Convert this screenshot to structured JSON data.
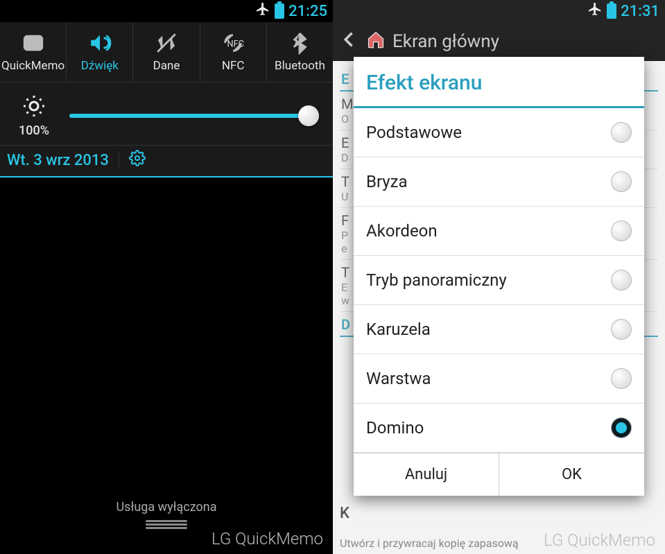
{
  "left": {
    "status": {
      "time": "21:25"
    },
    "toggles": [
      {
        "label": "QuickMemo",
        "active": false
      },
      {
        "label": "Dźwięk",
        "active": true
      },
      {
        "label": "Dane",
        "active": false
      },
      {
        "label": "NFC",
        "active": false
      },
      {
        "label": "Bluetooth",
        "active": false
      }
    ],
    "brightness_pct": "100%",
    "date": "Wt. 3 wrz 2013",
    "service_off": "Usługa wyłączona",
    "brand": "LG QuickMemo"
  },
  "right": {
    "status": {
      "time": "21:31"
    },
    "bg_title": "Ekran główny",
    "dialog": {
      "title": "Efekt ekranu",
      "options": [
        {
          "label": "Podstawowe",
          "selected": false
        },
        {
          "label": "Bryza",
          "selected": false
        },
        {
          "label": "Akordeon",
          "selected": false
        },
        {
          "label": "Tryb panoramiczny",
          "selected": false
        },
        {
          "label": "Karuzela",
          "selected": false
        },
        {
          "label": "Warstwa",
          "selected": false
        },
        {
          "label": "Domino",
          "selected": true
        }
      ],
      "cancel": "Anuluj",
      "ok": "OK"
    },
    "bg_k": "K",
    "bg_bottom": "Utwórz i przywracaj kopię zapasową",
    "brand": "LG QuickMemo"
  }
}
